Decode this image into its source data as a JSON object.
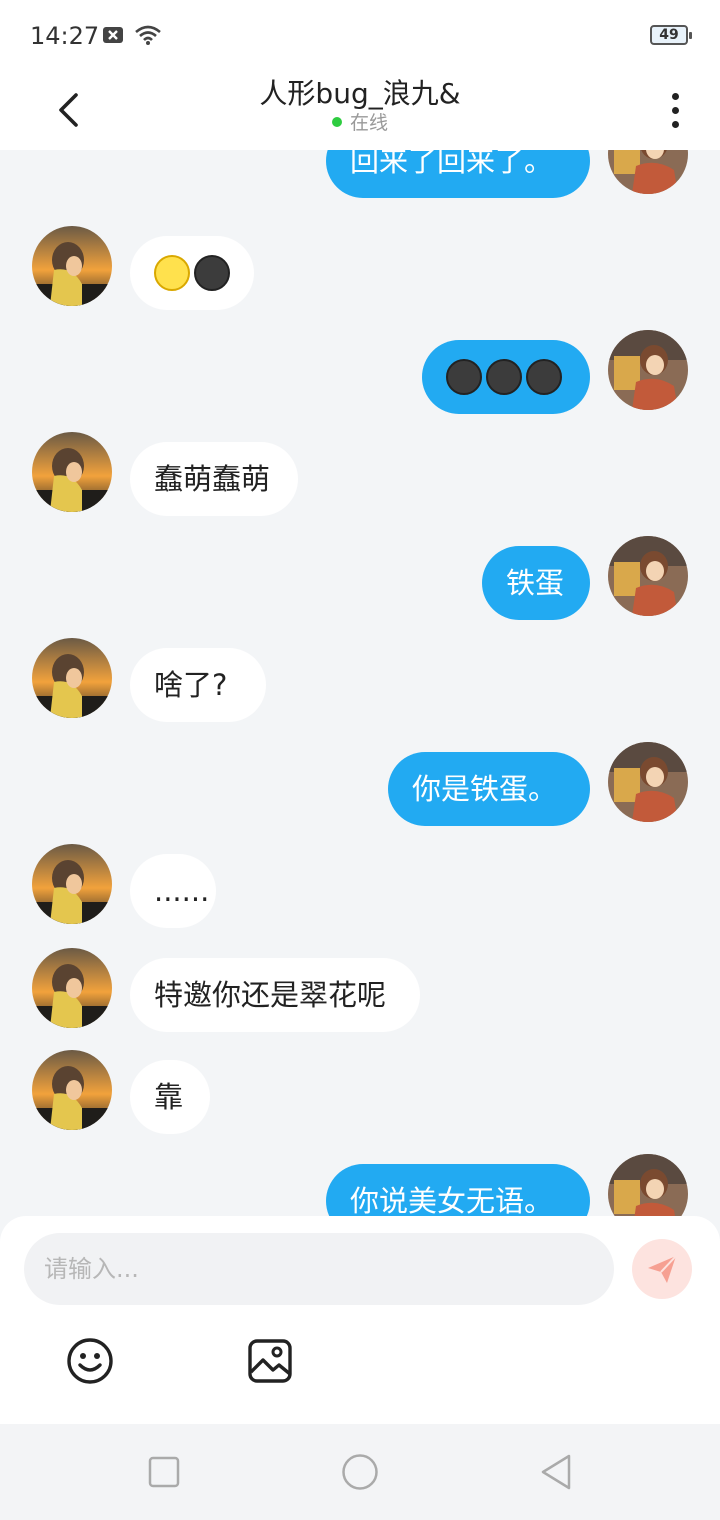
{
  "status_bar": {
    "time": "14:27",
    "battery": "49"
  },
  "header": {
    "title": "人形bug_浪九&",
    "status": "在线"
  },
  "colors": {
    "accent": "#22aaf2",
    "online": "#2ecc40",
    "send_button": "#fde3df"
  },
  "messages": [
    {
      "side": "right",
      "text": "回来了回来了。"
    },
    {
      "side": "left",
      "emoji": [
        "slightly-smiling-face",
        "dark-smiling-face"
      ]
    },
    {
      "side": "right",
      "emoji": [
        "dark-smiling-face",
        "dark-smiling-face",
        "dark-smiling-face"
      ]
    },
    {
      "side": "left",
      "text": "蠢萌蠢萌"
    },
    {
      "side": "right",
      "text": "铁蛋"
    },
    {
      "side": "left",
      "text": "啥了?"
    },
    {
      "side": "right",
      "text": "你是铁蛋。"
    },
    {
      "side": "left",
      "text": "......"
    },
    {
      "side": "left",
      "text": "特邀你还是翠花呢"
    },
    {
      "side": "left",
      "text": "靠"
    },
    {
      "side": "right",
      "text": "你说美女无语。"
    }
  ],
  "composer": {
    "placeholder": "请输入..."
  },
  "icons": {
    "back": "chevron-left-icon",
    "more": "more-vertical-icon",
    "send": "send-icon",
    "emoji": "emoji-icon",
    "image": "image-icon"
  }
}
